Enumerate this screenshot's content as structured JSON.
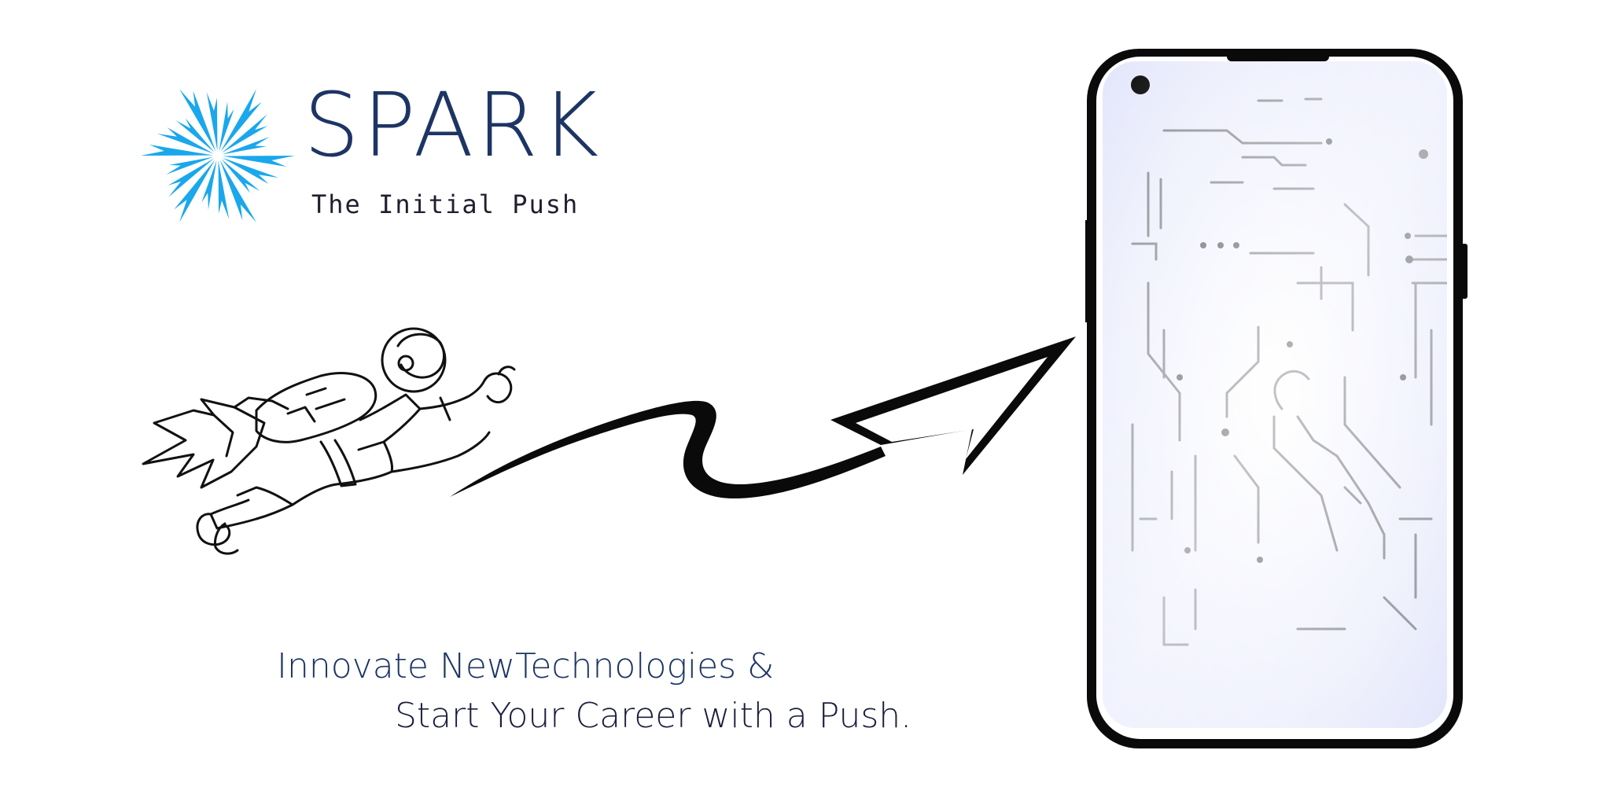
{
  "brand": {
    "name": "SPARK",
    "tagline": "The Initial Push",
    "accent_color": "#1aa7ec",
    "text_color": "#1d3564"
  },
  "headline": {
    "line1": "Innovate NewTechnologies &",
    "line2": "Start Your Career with a Push."
  },
  "illustration": {
    "figure_icon": "astronaut-flying-icon",
    "arrow_icon": "curvy-arrow-icon",
    "device_icon": "smartphone-circuit-icon"
  }
}
